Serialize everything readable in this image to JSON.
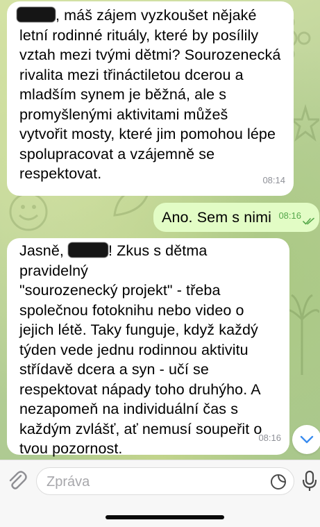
{
  "messages": [
    {
      "direction": "incoming",
      "lines_after_redaction": ", máš zájem vyzkoušet nějaké",
      "rest": "letní rodinné rituály, které by posílily\nvztah mezi tvými dětmi? Sourozenecká\nrivalita mezi třináctiletou dcerou a\nmladším synem je běžná, ale s\npromyšlenými aktivitami můžeš\nvytvořit mosty, které jim pomohou lépe\nspolupracovat a vzájemně se\nrespektovat.",
      "time": "08:14"
    },
    {
      "direction": "outgoing",
      "text": "Ano. Sem s nimi",
      "time": "08:16",
      "status": "read"
    },
    {
      "direction": "incoming",
      "lead": "Jasně, ",
      "after_redaction": "! Zkus s dětma pravidelný",
      "rest": "\"sourozenecký projekt\" - třeba\nspolečnou fotoknihu nebo video o\njejich létě. Taky funguje, když každý\ntýden vede jednu rodinnou aktivitu\nstřídavě dcera a syn - učí se\nrespektovat nápady toho druhýho. A\nnezapomeň na individuální čas s\nkaždým zvlášť, ať nemusí soupeřit o\ntvou pozornost.",
      "time": "08:16"
    }
  ],
  "composer": {
    "placeholder": "Zpráva",
    "attach_icon": "paperclip-icon",
    "sticker_icon": "sticker-icon",
    "mic_icon": "microphone-icon"
  },
  "scroll_down_icon": "chevron-down-icon",
  "colors": {
    "outgoing_bubble": "#e2fcc5",
    "incoming_bubble": "#ffffff",
    "accent": "#3a8cf0",
    "read_check": "#56a84b"
  }
}
